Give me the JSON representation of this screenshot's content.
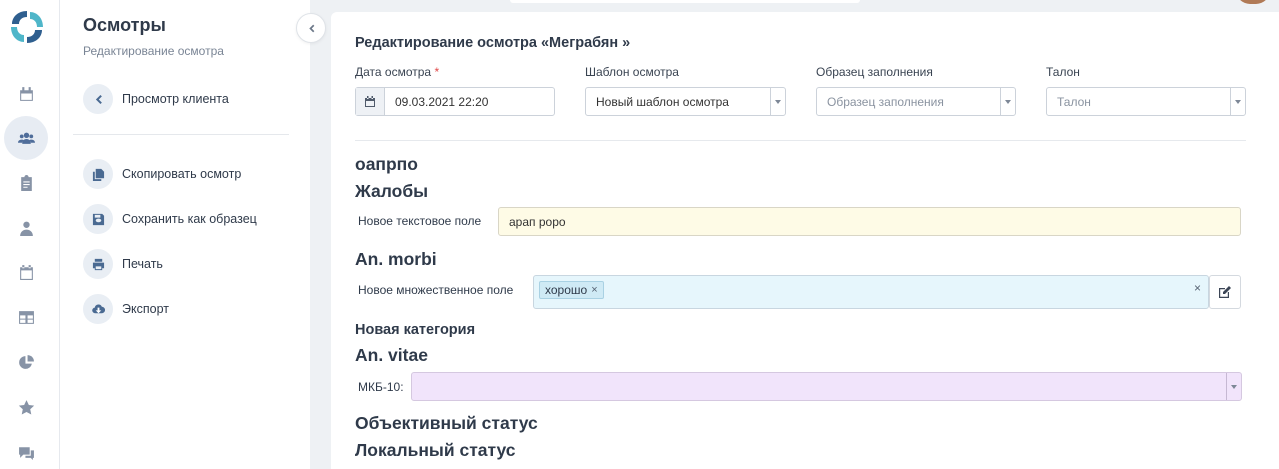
{
  "rail": {
    "items": [
      "calendar-icon",
      "users-icon",
      "clipboard-icon",
      "user-doctor-icon",
      "calendar-check-icon",
      "table-icon",
      "pie-chart-icon",
      "star-icon",
      "chat-icon"
    ]
  },
  "panel": {
    "title": "Осмотры",
    "subtitle": "Редактирование осмотра",
    "back_label": "Просмотр клиента",
    "actions": [
      {
        "label": "Скопировать осмотр",
        "icon": "copy-icon"
      },
      {
        "label": "Сохранить как образец",
        "icon": "save-icon"
      },
      {
        "label": "Печать",
        "icon": "print-icon"
      },
      {
        "label": "Экспорт",
        "icon": "cloud-download-icon"
      }
    ]
  },
  "form": {
    "title": "Редактирование осмотра «Меграбян »",
    "date": {
      "label": "Дата осмотра",
      "required_mark": "*",
      "value": "09.03.2021 22:20"
    },
    "template": {
      "label": "Шаблон осмотра",
      "value": "Новый шаблон осмотра"
    },
    "sample": {
      "label": "Образец заполнения",
      "placeholder": "Образец заполнения"
    },
    "ticket": {
      "label": "Талон",
      "placeholder": "Талон"
    }
  },
  "sections": {
    "s1": "оапрпо",
    "s2": "Жалобы",
    "text_field_label": "Новое текстовое поле",
    "text_field_value": "арап роро",
    "s3": "An. morbi",
    "multi_field_label": "Новое множественное поле",
    "multi_tag": "хорошо",
    "tag_remove": "×",
    "multi_clear": "×",
    "category": "Новая категория",
    "s4": "An. vitae",
    "mkb_label": "МКБ-10:",
    "s5": "Объективный статус",
    "s6": "Локальный статус"
  }
}
